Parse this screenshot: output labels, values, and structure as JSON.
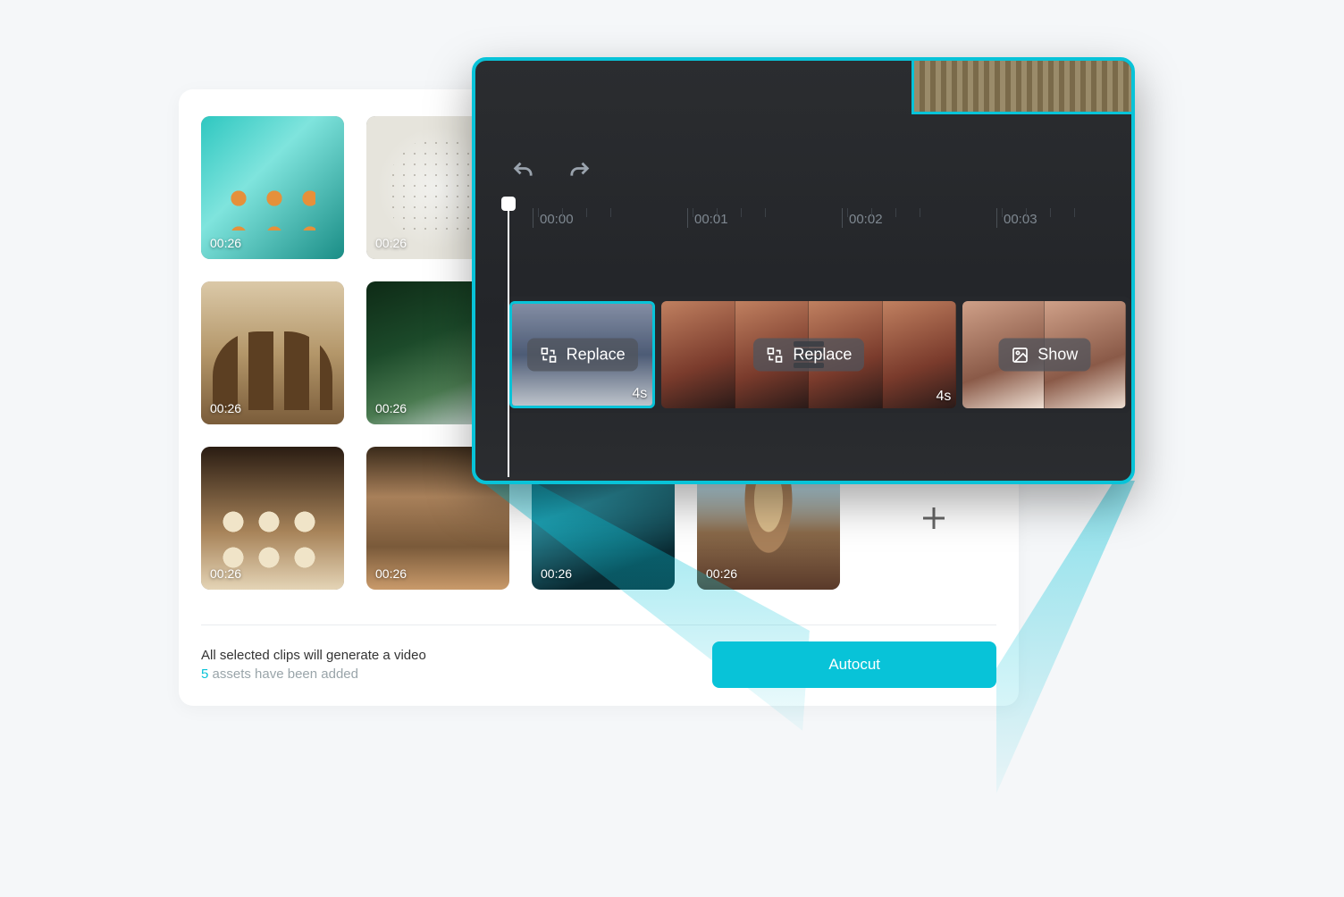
{
  "assets": {
    "items": [
      {
        "duration": "00:26"
      },
      {
        "duration": "00:26"
      },
      {
        "duration": "00:26"
      },
      {
        "duration": "00:26"
      },
      {
        "duration": "00:26"
      },
      {
        "duration": "00:26"
      },
      {
        "duration": "00:26"
      },
      {
        "duration": "00:26"
      }
    ]
  },
  "footer": {
    "headline": "All selected clips will generate a video",
    "count": "5",
    "count_suffix": " assets have been added",
    "cta": "Autocut"
  },
  "timeline": {
    "ruler": [
      "00:00",
      "00:01",
      "00:02",
      "00:03"
    ],
    "clips": [
      {
        "action": "Replace",
        "duration": "4s"
      },
      {
        "action": "Replace",
        "duration": "4s"
      },
      {
        "action": "Show"
      }
    ]
  },
  "colors": {
    "accent": "#08c3d8"
  }
}
